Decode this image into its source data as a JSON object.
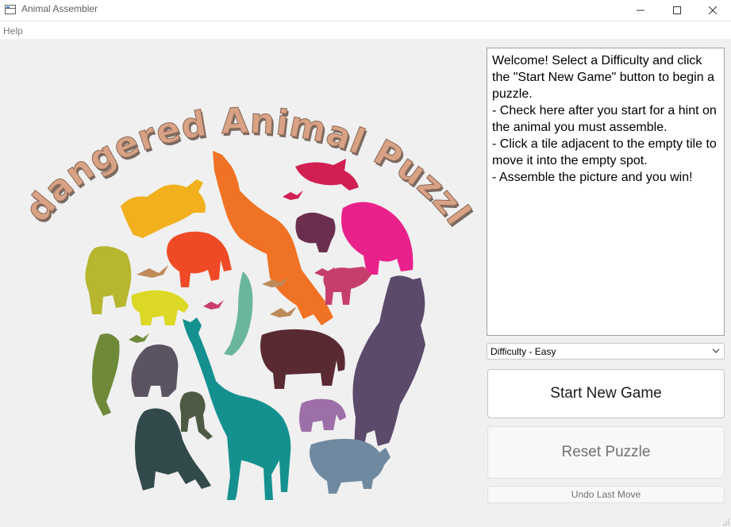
{
  "window": {
    "title": "Animal Assembler",
    "controls": {
      "minimize_icon": "minimize-icon",
      "maximize_icon": "maximize-icon",
      "close_icon": "close-icon"
    }
  },
  "menu": {
    "items": [
      {
        "label": "Help"
      }
    ]
  },
  "artwork": {
    "title": "Endangered Animal Puzzles",
    "colors": {
      "title_fill": "#d9a285",
      "title_shadow": "#7a6a62",
      "yellow": "#f2b01e",
      "orange": "#f07224",
      "red_orange": "#ee4a26",
      "crimson": "#d11f52",
      "magenta": "#e8218b",
      "plum": "#6b2e4e",
      "rose": "#c63e6c",
      "olive": "#b7b62f",
      "lime_yellow": "#dcd826",
      "sea_green": "#6ab59e",
      "teal": "#14918f",
      "maroon": "#5a2a33",
      "slate_purple": "#5c4a6b",
      "lavender": "#9d6fa8",
      "gray_blue": "#6f8aa0",
      "moss": "#6e8a39",
      "charcoal_purple": "#5b5262",
      "dark_teal": "#324a4c",
      "dark_olive": "#4e5a43",
      "bird_brown": "#bf8a5a"
    }
  },
  "panel": {
    "instructions": "Welcome! Select a Difficulty and click the \"Start New Game\" button to begin a puzzle.\n- Check here after you start for a hint on the animal you must assemble.\n- Click a tile adjacent to the empty tile to move it into the empty spot.\n- Assemble the picture and you win!",
    "difficulty": {
      "selected": "Difficulty - Easy",
      "icon": "chevron-down-icon"
    },
    "buttons": {
      "start": "Start New Game",
      "reset": "Reset Puzzle",
      "undo": "Undo Last Move"
    }
  }
}
